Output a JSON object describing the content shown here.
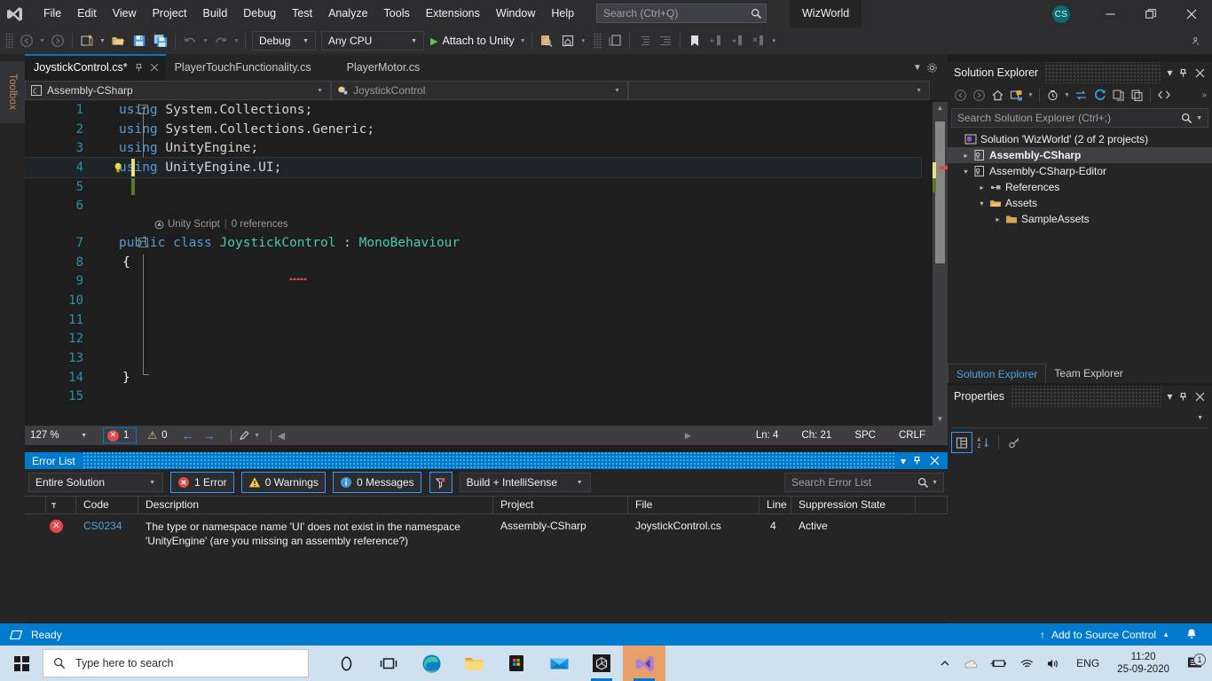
{
  "titlebar": {
    "logo_icon": "visual-studio-logo",
    "menus": [
      "File",
      "Edit",
      "View",
      "Project",
      "Build",
      "Debug",
      "Test",
      "Analyze",
      "Tools",
      "Extensions",
      "Window",
      "Help"
    ],
    "search_placeholder": "Search (Ctrl+Q)",
    "search_icon": "search-icon",
    "project_name": "WizWorld",
    "account_initials": "CS",
    "minimize": "─",
    "maximize": "❐",
    "close": "✕"
  },
  "toolbar": {
    "back_icon": "navigate-back-icon",
    "forward_icon": "navigate-forward-icon",
    "new_project_icon": "new-project-icon",
    "open_file_icon": "open-file-icon",
    "save_icon": "save-icon",
    "save_all_icon": "save-all-icon",
    "undo_icon": "undo-icon",
    "redo_icon": "redo-icon",
    "config": "Debug",
    "platform": "Any CPU",
    "run_label": "Attach to Unity",
    "run_icon": "play-icon",
    "find_icon": "find-in-files-icon",
    "home_icon": "home-icon",
    "toggle_icon": "toggle-icon",
    "comment_icon": "comment-icon",
    "indent_out_icon": "outdent-icon",
    "indent_in_icon": "indent-icon",
    "bookmark_icon": "bookmark-icon",
    "bookmark_prev_icon": "previous-bookmark-icon",
    "bookmark_next_icon": "next-bookmark-icon",
    "bookmark_clear_icon": "clear-bookmarks-icon",
    "overflow_icon": "toolbar-overflow-icon",
    "far_right_icon": "manage-connections-icon"
  },
  "toolbox": {
    "label": "Toolbox"
  },
  "editor": {
    "tabs": [
      {
        "label": "JoystickControl.cs*",
        "active": true,
        "pin_icon": "pin-icon",
        "close_icon": "close-icon"
      },
      {
        "label": "PlayerTouchFunctionality.cs",
        "active": false
      },
      {
        "label": "PlayerMotor.cs",
        "active": false
      }
    ],
    "tabstrip_overflow_icon": "tab-list-icon",
    "tabstrip_settings_icon": "gear-icon",
    "navbar": {
      "project": "Assembly-CSharp",
      "project_icon": "csharp-project-icon",
      "type": "JoystickControl",
      "type_icon": "class-icon",
      "member": ""
    },
    "codelens": {
      "unity_icon": "unity-icon",
      "label": "Unity Script",
      "separator": "|",
      "references": "0 references"
    },
    "lines": [
      {
        "num": "1",
        "fold": "−",
        "tokens": [
          [
            "k-blue",
            "using"
          ],
          [
            "k-txt",
            " System.Collections;"
          ]
        ]
      },
      {
        "num": "2",
        "tokens": [
          [
            "k-blue",
            "using"
          ],
          [
            "k-txt",
            " System.Collections.Generic;"
          ]
        ]
      },
      {
        "num": "3",
        "tokens": [
          [
            "k-blue",
            "using"
          ],
          [
            "k-txt",
            " UnityEngine;"
          ]
        ]
      },
      {
        "num": "4",
        "bulb": true,
        "change": "yellow",
        "highlight": true,
        "tokens": [
          [
            "k-blue",
            "using"
          ],
          [
            "k-txt",
            " UnityEngine.UI;"
          ]
        ]
      },
      {
        "num": "5",
        "change": "green",
        "tokens": []
      },
      {
        "num": "6",
        "tokens": []
      },
      {
        "num": "7",
        "fold": "−",
        "tokens": [
          [
            "k-blue",
            "public class "
          ],
          [
            "k-cyan",
            "JoystickControl"
          ],
          [
            "k-txt",
            " : "
          ],
          [
            "k-cyan",
            "MonoBehaviour"
          ]
        ]
      },
      {
        "num": "8",
        "tokens": [
          [
            "k-txt",
            "{"
          ]
        ]
      },
      {
        "num": "9",
        "tokens": []
      },
      {
        "num": "10",
        "tokens": []
      },
      {
        "num": "11",
        "tokens": []
      },
      {
        "num": "12",
        "tokens": []
      },
      {
        "num": "13",
        "tokens": []
      },
      {
        "num": "14",
        "tokens": [
          [
            "k-txt",
            "}"
          ]
        ]
      },
      {
        "num": "15",
        "tokens": []
      }
    ],
    "status": {
      "zoom": "127 %",
      "error_count": "1",
      "warning_count": "0",
      "prev_icon": "previous-error-icon",
      "next_icon": "next-error-icon",
      "brush_icon": "formatting-icon",
      "collapse_icon": "collapse-icon",
      "line": "Ln: 4",
      "column": "Ch: 21",
      "spaces": "SPC",
      "eol": "CRLF"
    }
  },
  "error_list": {
    "title": "Error List",
    "dropdown_icon": "chevron-down-icon",
    "pin_icon": "pin-icon",
    "close_icon": "close-icon",
    "scope": "Entire Solution",
    "errors_label": "1 Error",
    "warnings_label": "0 Warnings",
    "messages_label": "0 Messages",
    "filter_icon": "clear-filter-icon",
    "build_filter": "Build + IntelliSense",
    "search_placeholder": "Search Error List",
    "search_icon": "search-icon",
    "columns": [
      "",
      "Code",
      "Description",
      "Project",
      "File",
      "Line",
      "Suppression State"
    ],
    "rows": [
      {
        "severity_icon": "error-icon",
        "code": "CS0234",
        "description": "The type or namespace name 'UI' does not exist in the namespace 'UnityEngine' (are you missing an assembly reference?)",
        "project": "Assembly-CSharp",
        "file": "JoystickControl.cs",
        "line": "4",
        "suppression": "Active"
      }
    ]
  },
  "solution_explorer": {
    "title": "Solution Explorer",
    "dropdown_icon": "chevron-down-icon",
    "pin_icon": "pin-icon",
    "close_icon": "close-icon",
    "toolbar_icons": [
      "back-icon",
      "forward-icon",
      "home-icon",
      "pending-changes-icon",
      "chevron-down-icon",
      "show-all-files-icon",
      "chevron-down-icon",
      "sync-icon",
      "refresh-icon",
      "collapse-all-icon",
      "properties-icon",
      "code-view-icon"
    ],
    "search_placeholder": "Search Solution Explorer (Ctrl+;)",
    "search_icon": "search-icon",
    "tree": [
      {
        "label": "Solution 'WizWorld' (2 of 2 projects)",
        "indent": 0,
        "expander": "",
        "icon": "solution-icon",
        "bold": false,
        "selected": false
      },
      {
        "label": "Assembly-CSharp",
        "indent": 1,
        "expander": "▸",
        "icon": "csharp-project-icon",
        "bold": true,
        "selected": true
      },
      {
        "label": "Assembly-CSharp-Editor",
        "indent": 1,
        "expander": "▾",
        "icon": "csharp-project-icon",
        "bold": false,
        "selected": false
      },
      {
        "label": "References",
        "indent": 2,
        "expander": "▸",
        "icon": "references-icon",
        "bold": false,
        "selected": false
      },
      {
        "label": "Assets",
        "indent": 2,
        "expander": "▾",
        "icon": "folder-open-icon",
        "bold": false,
        "selected": false
      },
      {
        "label": "SampleAssets",
        "indent": 3,
        "expander": "▸",
        "icon": "folder-icon",
        "bold": false,
        "selected": false
      }
    ],
    "doc_tabs": [
      {
        "label": "Solution Explorer",
        "active": true
      },
      {
        "label": "Team Explorer",
        "active": false
      }
    ]
  },
  "properties": {
    "title": "Properties",
    "dropdown_icon": "chevron-down-icon",
    "pin_icon": "pin-icon",
    "close_icon": "close-icon",
    "selector_value": "",
    "categorized_icon": "categorized-view-icon",
    "alphabetical_icon": "alphabetical-sort-icon",
    "properties_icon": "property-pages-icon"
  },
  "vs_status": {
    "ready_icon": "ready-icon",
    "ready": "Ready",
    "source_control_icon": "upload-icon",
    "source_control": "Add to Source Control",
    "source_control_caret": "▲",
    "bell_icon": "notification-bell-icon"
  },
  "taskbar": {
    "start_icon": "windows-start-icon",
    "search_placeholder": "Type here to search",
    "search_icon": "search-icon",
    "apps": [
      {
        "name": "cortana-icon"
      },
      {
        "name": "task-view-icon"
      },
      {
        "name": "edge-icon"
      },
      {
        "name": "file-explorer-icon"
      },
      {
        "name": "microsoft-store-icon"
      },
      {
        "name": "mail-icon"
      },
      {
        "name": "unity-icon"
      },
      {
        "name": "visual-studio-icon"
      }
    ],
    "tray_icons": [
      "show-hidden-icons",
      "onedrive-icon",
      "battery-icon",
      "wifi-icon",
      "volume-icon"
    ],
    "language": "ENG",
    "time": "11:20",
    "date": "25-09-2020",
    "notification_icon": "action-center-icon",
    "notification_count": "1"
  },
  "colors": {
    "accent": "#007acc",
    "error": "#e04a4a",
    "warning": "#f2c94c",
    "bg_dark": "#1e1e1e",
    "bg_chrome": "#2d2d30",
    "bg_panel": "#252526",
    "keyword": "#569cd6",
    "type": "#4ec9b0",
    "linenum": "#2b91af"
  }
}
